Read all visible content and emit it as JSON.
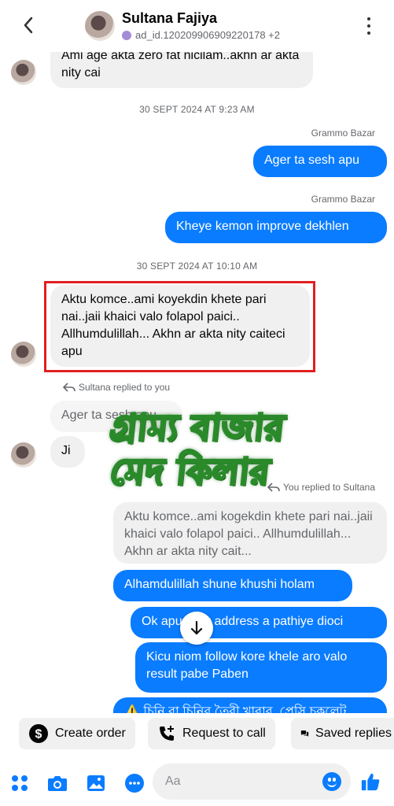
{
  "header": {
    "name": "Sultana Fajiya",
    "subtitle": "ad_id.120209906909220178 +2"
  },
  "messages": {
    "m1": "Ami age akta zero fat nicilam..akhn ar akta nity cai",
    "ts1": "30 SEPT 2024 AT 9:23 AM",
    "sender1": "Grammo Bazar",
    "m2": "Ager ta sesh apu",
    "sender2": "Grammo Bazar",
    "m3": "Kheye kemon improve dekhlen",
    "ts2": "30 SEPT 2024 AT 10:10 AM",
    "m4": "Aktu komce..ami koyekdin khete pari nai..jaii khaici valo folapol  paici.. Allhumdulillah... Akhn ar akta nity caiteci apu",
    "reply1_label": "Sultana replied to you",
    "reply1_quote": "Ager ta sesh apu",
    "m5": "Ji",
    "reply2_label": "You replied to Sultana",
    "reply2_quote": "Aktu komce..ami kogekdin khete pari nai..jaii khaici valo folapol  paici.. Allhumdulillah... Akhn ar akta nity cait...",
    "m6": "Alhamdulillah shune khushi holam",
    "m7": "Ok apu ager address a pathiye dioci",
    "m8": "Kicu niom follow kore khele aro valo result pabe Paben",
    "m9": "⚠️ চিনি বা চিনির তৈরী খাবার, প্রেসি চকলেট"
  },
  "watermark": {
    "line1": "গ্রাম্য বাজার",
    "line2": "মেদ কিলার"
  },
  "quick_actions": {
    "create_order": "Create order",
    "request_call": "Request to call",
    "saved_replies": "Saved replies"
  },
  "composer": {
    "placeholder": "Aa"
  },
  "colors": {
    "accent": "#0a7cff",
    "highlight": "#e02020"
  }
}
